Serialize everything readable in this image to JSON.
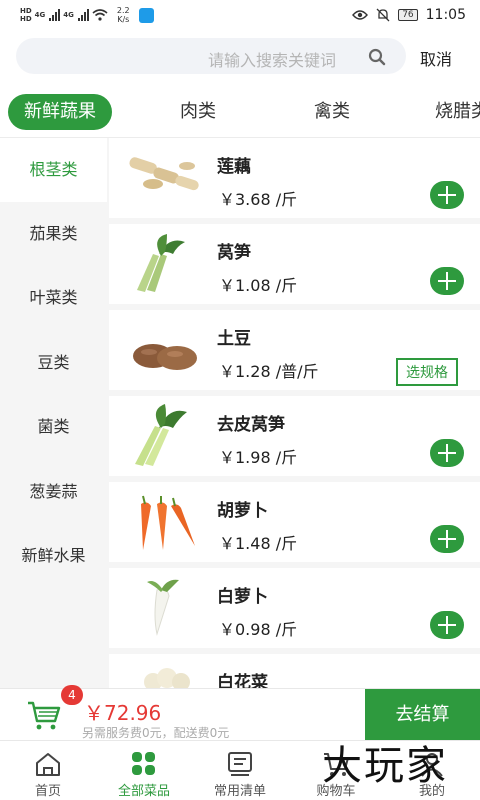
{
  "status_bar": {
    "hd": "HD",
    "net": "4G",
    "speed_value": "2.2",
    "speed_unit": "K/s",
    "battery": "76",
    "time": "11:05"
  },
  "search": {
    "placeholder": "请输入搜索关键词",
    "cancel_label": "取消"
  },
  "category_tabs": [
    {
      "label": "新鲜蔬果",
      "active": true
    },
    {
      "label": "肉类"
    },
    {
      "label": "禽类"
    },
    {
      "label": "烧腊类"
    }
  ],
  "sidebar": {
    "items": [
      {
        "label": "根茎类",
        "active": true
      },
      {
        "label": "茄果类"
      },
      {
        "label": "叶菜类"
      },
      {
        "label": "豆类"
      },
      {
        "label": "菌类"
      },
      {
        "label": "葱姜蒜"
      },
      {
        "label": "新鲜水果"
      }
    ]
  },
  "products": [
    {
      "name": "莲藕",
      "price": "￥3.68 /斤",
      "action": "add",
      "icon": "lotus-root-image"
    },
    {
      "name": "莴笋",
      "price": "￥1.08 /斤",
      "action": "add",
      "icon": "lettuce-stem-image"
    },
    {
      "name": "土豆",
      "price": "￥1.28 /普/斤",
      "action": "spec",
      "spec_label": "选规格",
      "icon": "potato-image"
    },
    {
      "name": "去皮莴笋",
      "price": "￥1.98 /斤",
      "action": "add",
      "icon": "peeled-lettuce-image"
    },
    {
      "name": "胡萝卜",
      "price": "￥1.48 /斤",
      "action": "add",
      "icon": "carrot-image"
    },
    {
      "name": "白萝卜",
      "price": "￥0.98 /斤",
      "action": "add",
      "icon": "radish-image"
    },
    {
      "name": "白花菜",
      "price": "",
      "action": "none",
      "icon": "cauliflower-image"
    }
  ],
  "cart": {
    "count": "4",
    "total": "￥72.96",
    "note": "另需服务费0元，配送费0元",
    "checkout_label": "去结算"
  },
  "bottom_nav": [
    {
      "label": "首页",
      "icon": "home-icon"
    },
    {
      "label": "全部菜品",
      "icon": "grid-icon",
      "active": true
    },
    {
      "label": "常用清单",
      "icon": "list-icon"
    },
    {
      "label": "购物车",
      "icon": "cart-icon"
    },
    {
      "label": "我的",
      "icon": "user-icon"
    }
  ],
  "watermark": "大玩家",
  "colors": {
    "accent": "#2e9a3e",
    "price_red": "#e53935",
    "sidebar_bg": "#f5f5f5"
  }
}
